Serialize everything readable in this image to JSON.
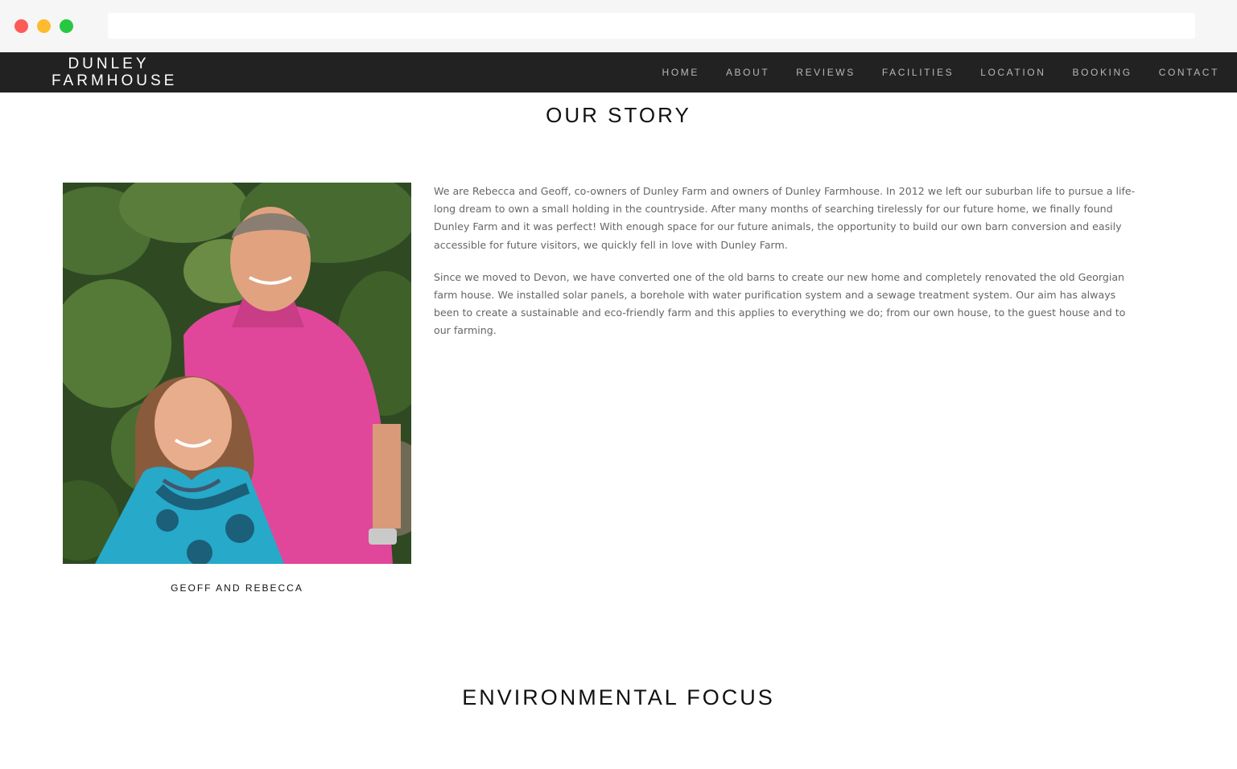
{
  "browser": {
    "address_value": "",
    "traffic_light_colors": [
      "#fc5c57",
      "#fdbb2e",
      "#27c840"
    ]
  },
  "site": {
    "logo_line1": "DUNLEY",
    "logo_line2": "FARMHOUSE",
    "nav": [
      "HOME",
      "ABOUT",
      "REVIEWS",
      "FACILITIES",
      "LOCATION",
      "BOOKING",
      "CONTACT"
    ],
    "navbar_color": "#222222"
  },
  "story": {
    "title": "OUR STORY",
    "caption": "GEOFF AND REBECCA",
    "paragraphs": [
      "We are Rebecca and Geoff, co-owners of Dunley Farm and owners of Dunley Farmhouse. In 2012 we left our suburban life to pursue a life-long dream to own a small holding in the countryside. After many months of searching tirelessly for our future home, we finally found Dunley Farm and it was perfect! With enough space for our future animals, the opportunity to build our own barn conversion and easily accessible for future visitors, we quickly fell in love with Dunley Farm.",
      "Since we moved to Devon, we have converted one of the old barns to create our new home and completely renovated the old Georgian farm house. We installed solar panels, a borehole with water purification system and a sewage treatment system. Our aim has always been to create a sustainable and eco-friendly farm and this applies to everything we do; from our own house, to the guest house and to our farming."
    ]
  },
  "environment": {
    "title": "ENVIRONMENTAL FOCUS"
  }
}
